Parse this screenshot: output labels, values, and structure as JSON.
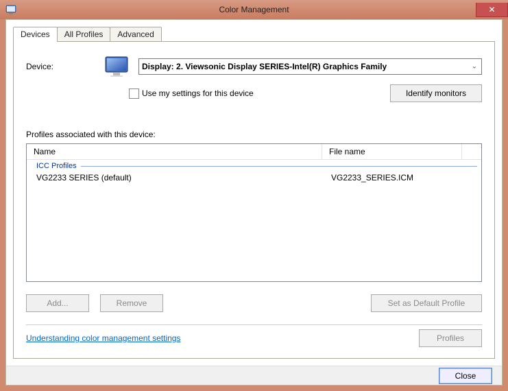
{
  "window": {
    "title": "Color Management",
    "close_glyph": "✕"
  },
  "tabs": [
    {
      "label": "Devices"
    },
    {
      "label": "All Profiles"
    },
    {
      "label": "Advanced"
    }
  ],
  "device": {
    "label": "Device:",
    "selected": "Display: 2. Viewsonic Display SERIES-Intel(R) Graphics Family",
    "chevron": "⌄",
    "use_my_settings_label": "Use my settings for this device",
    "identify_label": "Identify monitors"
  },
  "profiles": {
    "assoc_label": "Profiles associated with this device:",
    "col_name": "Name",
    "col_fname": "File name",
    "group": "ICC Profiles",
    "rows": [
      {
        "name": "VG2233 SERIES (default)",
        "file": "VG2233_SERIES.ICM"
      }
    ]
  },
  "buttons": {
    "add": "Add...",
    "remove": "Remove",
    "set_default": "Set as Default Profile",
    "profiles": "Profiles",
    "close": "Close"
  },
  "link": {
    "understanding": "Understanding color management settings"
  }
}
